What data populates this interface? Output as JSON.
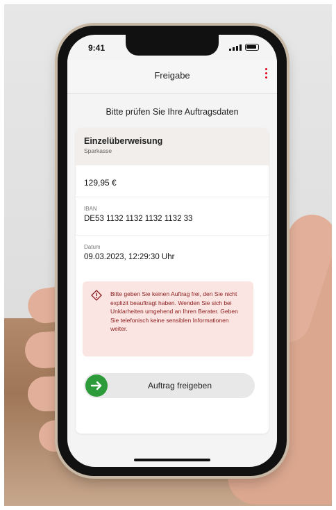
{
  "status_bar": {
    "time": "9:41"
  },
  "header": {
    "title": "Freigabe"
  },
  "subtitle": "Bitte prüfen Sie Ihre Auftragsdaten",
  "order": {
    "type": "Einzelüberweisung",
    "bank": "Sparkasse",
    "amount": "129,95 €",
    "iban_label": "IBAN",
    "iban": "DE53 1132 1132 1132 1132 33",
    "date_label": "Datum",
    "date": "09.03.2023, 12:29:30 Uhr"
  },
  "warning": {
    "text": "Bitte geben Sie keinen Auftrag frei, den Sie nicht explizit beauftragt haben. Wenden Sie sich bei Unklarheiten umgehend an Ihren Berater. Geben Sie telefonisch keine sensiblen Informationen weiter."
  },
  "release_button": {
    "label": "Auftrag freigeben"
  },
  "colors": {
    "brand_red": "#e2001a",
    "confirm_green": "#2e9b3a",
    "warning_bg": "#fbe5e2",
    "warning_text": "#8a1c1c"
  }
}
